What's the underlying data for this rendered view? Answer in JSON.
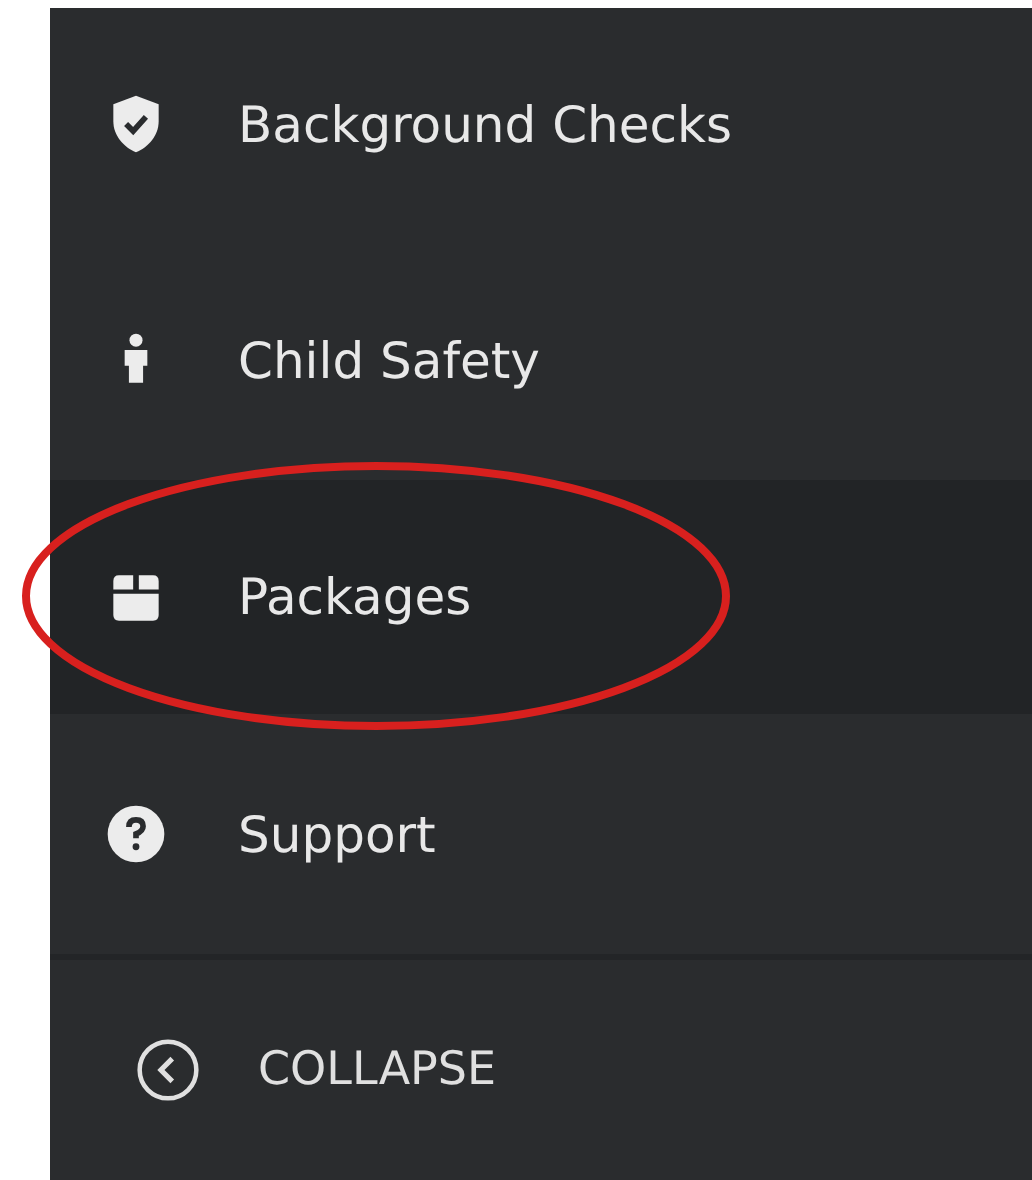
{
  "menu_items": [
    {
      "label": "Background Checks",
      "selected": false,
      "circled": false
    },
    {
      "label": "Child Safety",
      "selected": false,
      "circled": false
    },
    {
      "label": "Packages",
      "selected": true,
      "circled": true
    },
    {
      "label": "Support",
      "selected": false,
      "circled": false
    }
  ],
  "collapse_button": {
    "label": "COLLAPSE"
  }
}
